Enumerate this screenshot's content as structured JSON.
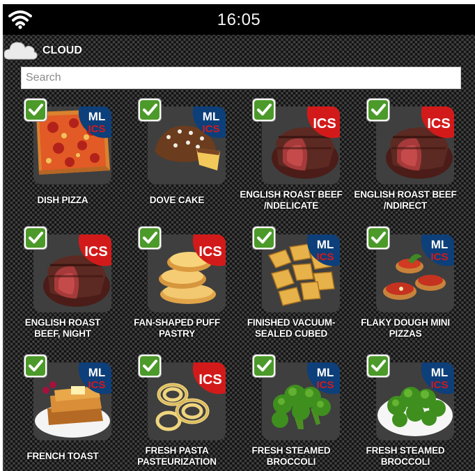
{
  "status_bar": {
    "time": "16:05"
  },
  "section": {
    "label": "CLOUD"
  },
  "search": {
    "placeholder": "Search",
    "value": ""
  },
  "colors": {
    "ics_red": "#d31a1a",
    "ml_blue": "#0d3f7a",
    "check_green": "#4c9a2a"
  },
  "recipes": [
    {
      "name": "DISH PIZZA",
      "badge": [
        "ML",
        "ICS"
      ],
      "checked": true,
      "image": "pizza"
    },
    {
      "name": "DOVE CAKE",
      "badge": [
        "ML",
        "ICS"
      ],
      "checked": true,
      "image": "cake"
    },
    {
      "name": "ENGLISH ROAST BEEF /NDELICATE",
      "badge": [
        "ICS"
      ],
      "checked": true,
      "image": "roast"
    },
    {
      "name": "ENGLISH ROAST BEEF /NDIRECT",
      "badge": [
        "ICS"
      ],
      "checked": true,
      "image": "roast"
    },
    {
      "name": "ENGLISH ROAST BEEF, NIGHT",
      "badge": [
        "ICS"
      ],
      "checked": true,
      "image": "roast"
    },
    {
      "name": "FAN-SHAPED PUFF PASTRY",
      "badge": [
        "ICS"
      ],
      "checked": true,
      "image": "pastry"
    },
    {
      "name": "FINISHED VACUUM-SEALED CUBED",
      "badge": [
        "ML",
        "ICS"
      ],
      "checked": true,
      "image": "potato"
    },
    {
      "name": "FLAKY DOUGH MINI PIZZAS",
      "badge": [
        "ML",
        "ICS"
      ],
      "checked": true,
      "image": "minipizza"
    },
    {
      "name": "FRENCH TOAST",
      "badge": [
        "ML",
        "ICS"
      ],
      "checked": true,
      "image": "toast"
    },
    {
      "name": "FRESH PASTA PASTEURIZATION",
      "badge": [
        "ICS"
      ],
      "checked": true,
      "image": "pasta"
    },
    {
      "name": "FRESH STEAMED BROCCOLI",
      "badge": [
        "ML",
        "ICS"
      ],
      "checked": true,
      "image": "broccoli"
    },
    {
      "name": "FRESH STEAMED BROCCOLI",
      "badge": [
        "ML",
        "ICS"
      ],
      "checked": true,
      "image": "broccoli_plate"
    }
  ]
}
